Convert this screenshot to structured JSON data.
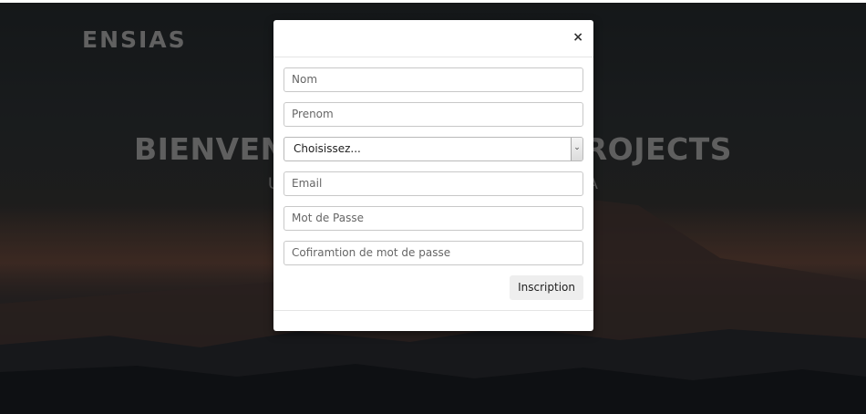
{
  "background": {
    "brand": "ENSIAS",
    "hero_title": "BIENVENUE SUR ENSIAS PROJECTS",
    "hero_subtitle": "Une plateforme de gestion des projets PFA"
  },
  "modal": {
    "close_label": "×",
    "fields": {
      "nom_placeholder": "Nom",
      "prenom_placeholder": "Prenom",
      "select_value": "Choisissez...",
      "email_placeholder": "Email",
      "password_placeholder": "Mot de Passe",
      "password_confirm_placeholder": "Cofiramtion de mot de passe"
    },
    "submit_label": "Inscription"
  },
  "icons": {
    "select_arrow": "chevron-down-icon",
    "close": "close-icon"
  },
  "colors": {
    "overlay": "#000000",
    "modal_bg": "#ffffff",
    "button_bg": "#eeeeee",
    "brand_text": "#8f8f8f"
  }
}
